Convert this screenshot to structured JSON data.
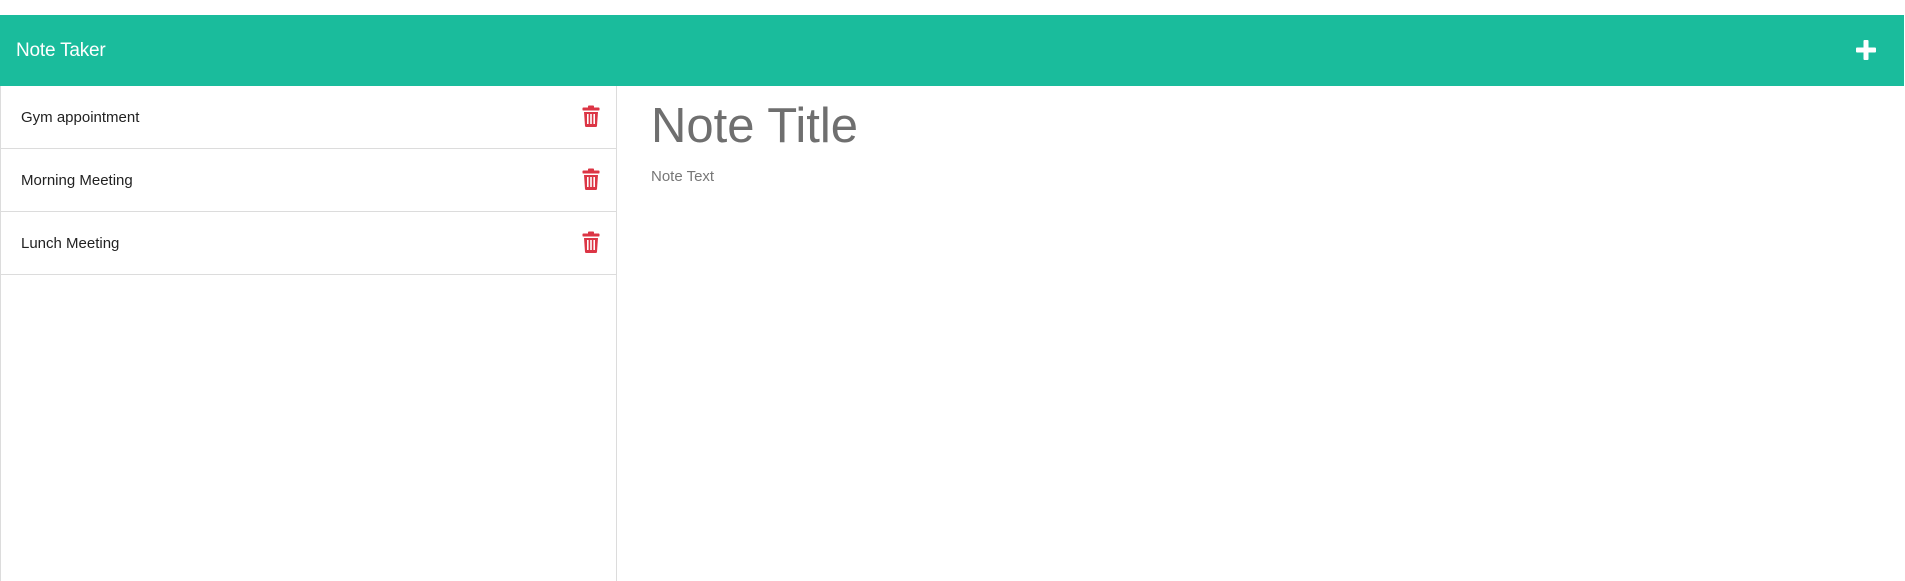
{
  "navbar": {
    "brand": "Note Taker",
    "add_icon": "plus-icon",
    "background": "#1abc9c",
    "text_color": "#ffffff"
  },
  "sidebar": {
    "notes": [
      {
        "title": "Gym appointment",
        "icon": "trash-icon"
      },
      {
        "title": "Morning Meeting",
        "icon": "trash-icon"
      },
      {
        "title": "Lunch Meeting",
        "icon": "trash-icon"
      }
    ],
    "delete_color": "#dc3545"
  },
  "editor": {
    "title_placeholder": "Note Title",
    "text_placeholder": "Note Text"
  }
}
